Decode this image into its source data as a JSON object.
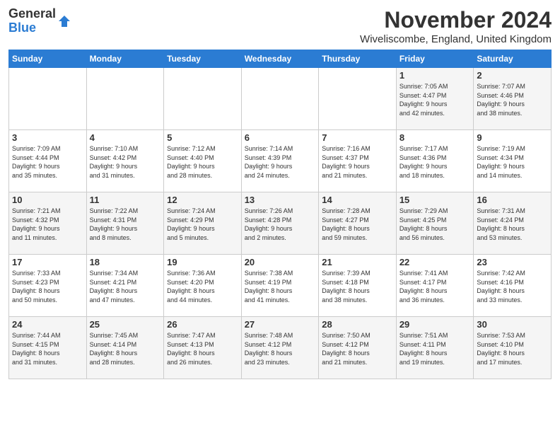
{
  "logo": {
    "line1": "General",
    "line2": "Blue"
  },
  "title": "November 2024",
  "location": "Wiveliscombe, England, United Kingdom",
  "weekdays": [
    "Sunday",
    "Monday",
    "Tuesday",
    "Wednesday",
    "Thursday",
    "Friday",
    "Saturday"
  ],
  "weeks": [
    [
      {
        "day": "",
        "info": ""
      },
      {
        "day": "",
        "info": ""
      },
      {
        "day": "",
        "info": ""
      },
      {
        "day": "",
        "info": ""
      },
      {
        "day": "",
        "info": ""
      },
      {
        "day": "1",
        "info": "Sunrise: 7:05 AM\nSunset: 4:47 PM\nDaylight: 9 hours\nand 42 minutes."
      },
      {
        "day": "2",
        "info": "Sunrise: 7:07 AM\nSunset: 4:46 PM\nDaylight: 9 hours\nand 38 minutes."
      }
    ],
    [
      {
        "day": "3",
        "info": "Sunrise: 7:09 AM\nSunset: 4:44 PM\nDaylight: 9 hours\nand 35 minutes."
      },
      {
        "day": "4",
        "info": "Sunrise: 7:10 AM\nSunset: 4:42 PM\nDaylight: 9 hours\nand 31 minutes."
      },
      {
        "day": "5",
        "info": "Sunrise: 7:12 AM\nSunset: 4:40 PM\nDaylight: 9 hours\nand 28 minutes."
      },
      {
        "day": "6",
        "info": "Sunrise: 7:14 AM\nSunset: 4:39 PM\nDaylight: 9 hours\nand 24 minutes."
      },
      {
        "day": "7",
        "info": "Sunrise: 7:16 AM\nSunset: 4:37 PM\nDaylight: 9 hours\nand 21 minutes."
      },
      {
        "day": "8",
        "info": "Sunrise: 7:17 AM\nSunset: 4:36 PM\nDaylight: 9 hours\nand 18 minutes."
      },
      {
        "day": "9",
        "info": "Sunrise: 7:19 AM\nSunset: 4:34 PM\nDaylight: 9 hours\nand 14 minutes."
      }
    ],
    [
      {
        "day": "10",
        "info": "Sunrise: 7:21 AM\nSunset: 4:32 PM\nDaylight: 9 hours\nand 11 minutes."
      },
      {
        "day": "11",
        "info": "Sunrise: 7:22 AM\nSunset: 4:31 PM\nDaylight: 9 hours\nand 8 minutes."
      },
      {
        "day": "12",
        "info": "Sunrise: 7:24 AM\nSunset: 4:29 PM\nDaylight: 9 hours\nand 5 minutes."
      },
      {
        "day": "13",
        "info": "Sunrise: 7:26 AM\nSunset: 4:28 PM\nDaylight: 9 hours\nand 2 minutes."
      },
      {
        "day": "14",
        "info": "Sunrise: 7:28 AM\nSunset: 4:27 PM\nDaylight: 8 hours\nand 59 minutes."
      },
      {
        "day": "15",
        "info": "Sunrise: 7:29 AM\nSunset: 4:25 PM\nDaylight: 8 hours\nand 56 minutes."
      },
      {
        "day": "16",
        "info": "Sunrise: 7:31 AM\nSunset: 4:24 PM\nDaylight: 8 hours\nand 53 minutes."
      }
    ],
    [
      {
        "day": "17",
        "info": "Sunrise: 7:33 AM\nSunset: 4:23 PM\nDaylight: 8 hours\nand 50 minutes."
      },
      {
        "day": "18",
        "info": "Sunrise: 7:34 AM\nSunset: 4:21 PM\nDaylight: 8 hours\nand 47 minutes."
      },
      {
        "day": "19",
        "info": "Sunrise: 7:36 AM\nSunset: 4:20 PM\nDaylight: 8 hours\nand 44 minutes."
      },
      {
        "day": "20",
        "info": "Sunrise: 7:38 AM\nSunset: 4:19 PM\nDaylight: 8 hours\nand 41 minutes."
      },
      {
        "day": "21",
        "info": "Sunrise: 7:39 AM\nSunset: 4:18 PM\nDaylight: 8 hours\nand 38 minutes."
      },
      {
        "day": "22",
        "info": "Sunrise: 7:41 AM\nSunset: 4:17 PM\nDaylight: 8 hours\nand 36 minutes."
      },
      {
        "day": "23",
        "info": "Sunrise: 7:42 AM\nSunset: 4:16 PM\nDaylight: 8 hours\nand 33 minutes."
      }
    ],
    [
      {
        "day": "24",
        "info": "Sunrise: 7:44 AM\nSunset: 4:15 PM\nDaylight: 8 hours\nand 31 minutes."
      },
      {
        "day": "25",
        "info": "Sunrise: 7:45 AM\nSunset: 4:14 PM\nDaylight: 8 hours\nand 28 minutes."
      },
      {
        "day": "26",
        "info": "Sunrise: 7:47 AM\nSunset: 4:13 PM\nDaylight: 8 hours\nand 26 minutes."
      },
      {
        "day": "27",
        "info": "Sunrise: 7:48 AM\nSunset: 4:12 PM\nDaylight: 8 hours\nand 23 minutes."
      },
      {
        "day": "28",
        "info": "Sunrise: 7:50 AM\nSunset: 4:12 PM\nDaylight: 8 hours\nand 21 minutes."
      },
      {
        "day": "29",
        "info": "Sunrise: 7:51 AM\nSunset: 4:11 PM\nDaylight: 8 hours\nand 19 minutes."
      },
      {
        "day": "30",
        "info": "Sunrise: 7:53 AM\nSunset: 4:10 PM\nDaylight: 8 hours\nand 17 minutes."
      }
    ]
  ]
}
